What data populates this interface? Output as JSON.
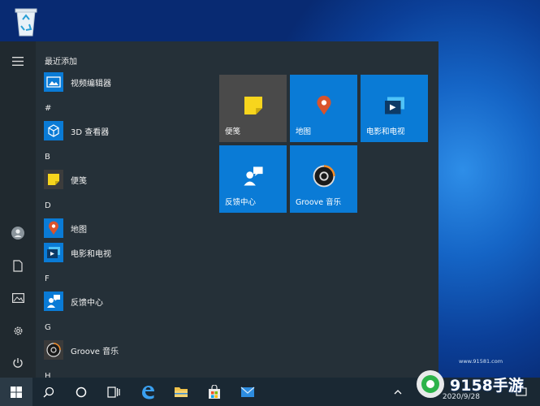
{
  "start_menu": {
    "sections": {
      "recent": "最近添加",
      "hash": "#",
      "b": "B",
      "d": "D",
      "f": "F",
      "g": "G",
      "h": "H"
    },
    "apps": {
      "video_editor": "视频编辑器",
      "viewer_3d": "3D 查看器",
      "sticky_notes": "便笺",
      "maps": "地图",
      "movies_tv": "电影和电视",
      "feedback": "反馈中心",
      "groove": "Groove 音乐"
    },
    "tiles": {
      "sticky_notes": "便笺",
      "maps": "地图",
      "movies_tv": "电影和电视",
      "feedback": "反馈中心",
      "groove": "Groove 音乐"
    }
  },
  "taskbar": {
    "date": "2020/9/28"
  },
  "watermark": {
    "brand": "9158手游",
    "url": "www.91581.com"
  },
  "colors": {
    "tile_blue": "#0a7bd6",
    "start_bg": "#253038",
    "taskbar_bg": "#1a2833",
    "sticky_yellow": "#f7d51d",
    "maps_red": "#d9532c"
  }
}
